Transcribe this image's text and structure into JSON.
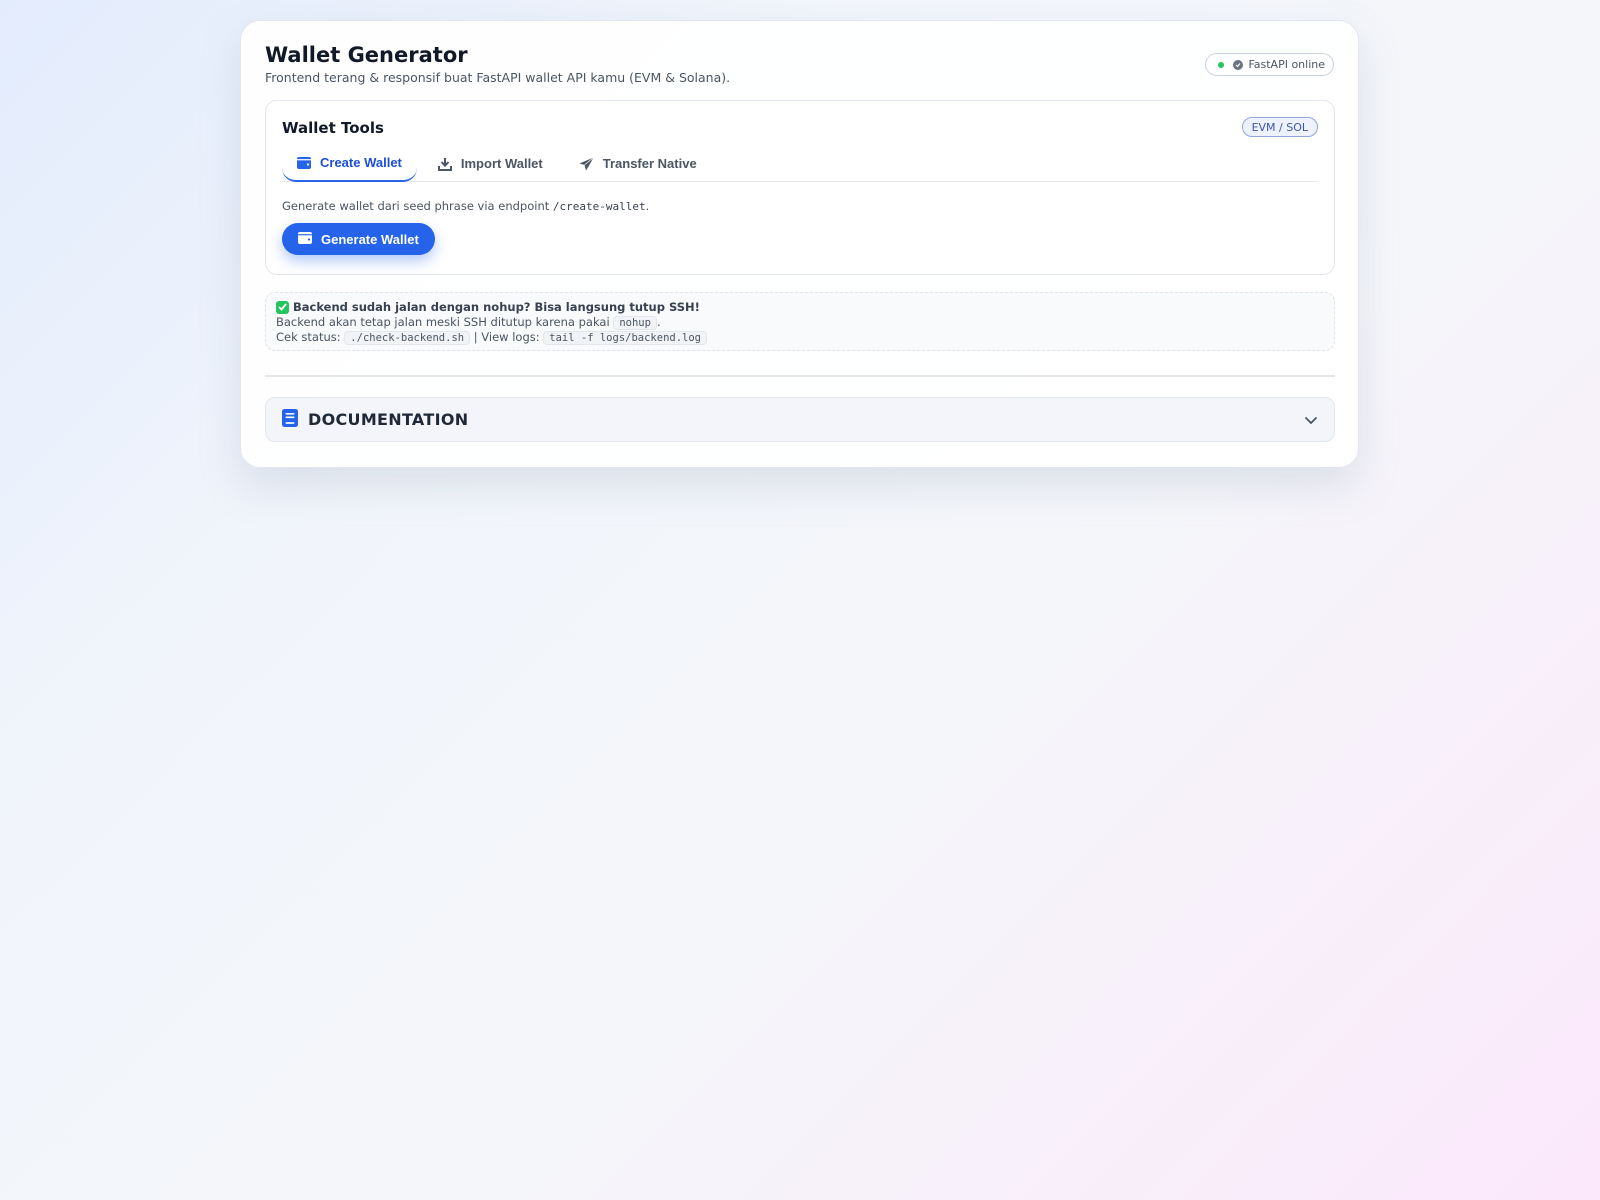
{
  "header": {
    "title": "Wallet Generator",
    "subtitle": "Frontend terang & responsif buat FastAPI wallet API kamu (EVM & Solana).",
    "status": "FastAPI online"
  },
  "tools": {
    "title": "Wallet Tools",
    "badge": "EVM / SOL",
    "tabs": [
      {
        "label": "Create Wallet",
        "icon": "wallet-icon",
        "active": true
      },
      {
        "label": "Import Wallet",
        "icon": "download-icon",
        "active": false
      },
      {
        "label": "Transfer Native",
        "icon": "paper-plane-icon",
        "active": false
      }
    ],
    "description_prefix": "Generate wallet dari seed phrase via endpoint",
    "description_endpoint": "/create-wallet",
    "description_suffix": ".",
    "generate_button": "Generate Wallet"
  },
  "note": {
    "heading": "Backend sudah jalan dengan nohup? Bisa langsung tutup SSH!",
    "line1_prefix": "Backend akan tetap jalan meski SSH ditutup karena pakai",
    "line1_code": "nohup",
    "line1_suffix": ".",
    "line2_label": "Cek status:",
    "line2_code1": "./check-backend.sh",
    "line2_sep": "| View logs:",
    "line2_code2": "tail -f logs/backend.log"
  },
  "docs": {
    "title": "DOCUMENTATION"
  },
  "colors": {
    "accent": "#2563eb",
    "status_online": "#22c55e"
  }
}
